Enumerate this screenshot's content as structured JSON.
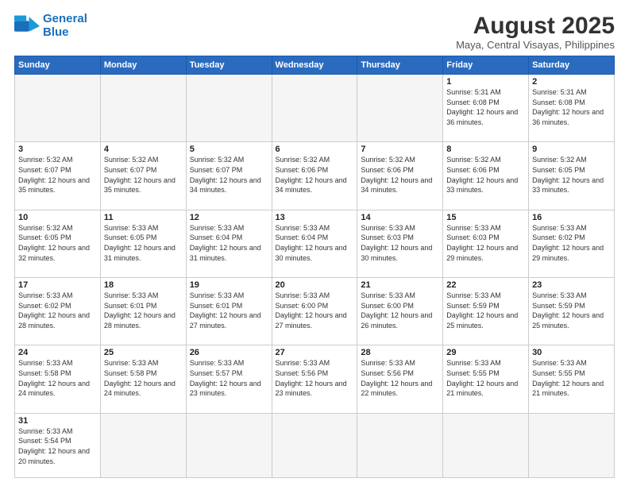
{
  "header": {
    "logo_general": "General",
    "logo_blue": "Blue",
    "month_title": "August 2025",
    "subtitle": "Maya, Central Visayas, Philippines"
  },
  "weekdays": [
    "Sunday",
    "Monday",
    "Tuesday",
    "Wednesday",
    "Thursday",
    "Friday",
    "Saturday"
  ],
  "weeks": [
    [
      {
        "day": "",
        "info": "",
        "empty": true
      },
      {
        "day": "",
        "info": "",
        "empty": true
      },
      {
        "day": "",
        "info": "",
        "empty": true
      },
      {
        "day": "",
        "info": "",
        "empty": true
      },
      {
        "day": "",
        "info": "",
        "empty": true
      },
      {
        "day": "1",
        "info": "Sunrise: 5:31 AM\nSunset: 6:08 PM\nDaylight: 12 hours\nand 36 minutes."
      },
      {
        "day": "2",
        "info": "Sunrise: 5:31 AM\nSunset: 6:08 PM\nDaylight: 12 hours\nand 36 minutes."
      }
    ],
    [
      {
        "day": "3",
        "info": "Sunrise: 5:32 AM\nSunset: 6:07 PM\nDaylight: 12 hours\nand 35 minutes."
      },
      {
        "day": "4",
        "info": "Sunrise: 5:32 AM\nSunset: 6:07 PM\nDaylight: 12 hours\nand 35 minutes."
      },
      {
        "day": "5",
        "info": "Sunrise: 5:32 AM\nSunset: 6:07 PM\nDaylight: 12 hours\nand 34 minutes."
      },
      {
        "day": "6",
        "info": "Sunrise: 5:32 AM\nSunset: 6:06 PM\nDaylight: 12 hours\nand 34 minutes."
      },
      {
        "day": "7",
        "info": "Sunrise: 5:32 AM\nSunset: 6:06 PM\nDaylight: 12 hours\nand 34 minutes."
      },
      {
        "day": "8",
        "info": "Sunrise: 5:32 AM\nSunset: 6:06 PM\nDaylight: 12 hours\nand 33 minutes."
      },
      {
        "day": "9",
        "info": "Sunrise: 5:32 AM\nSunset: 6:05 PM\nDaylight: 12 hours\nand 33 minutes."
      }
    ],
    [
      {
        "day": "10",
        "info": "Sunrise: 5:32 AM\nSunset: 6:05 PM\nDaylight: 12 hours\nand 32 minutes."
      },
      {
        "day": "11",
        "info": "Sunrise: 5:33 AM\nSunset: 6:05 PM\nDaylight: 12 hours\nand 31 minutes."
      },
      {
        "day": "12",
        "info": "Sunrise: 5:33 AM\nSunset: 6:04 PM\nDaylight: 12 hours\nand 31 minutes."
      },
      {
        "day": "13",
        "info": "Sunrise: 5:33 AM\nSunset: 6:04 PM\nDaylight: 12 hours\nand 30 minutes."
      },
      {
        "day": "14",
        "info": "Sunrise: 5:33 AM\nSunset: 6:03 PM\nDaylight: 12 hours\nand 30 minutes."
      },
      {
        "day": "15",
        "info": "Sunrise: 5:33 AM\nSunset: 6:03 PM\nDaylight: 12 hours\nand 29 minutes."
      },
      {
        "day": "16",
        "info": "Sunrise: 5:33 AM\nSunset: 6:02 PM\nDaylight: 12 hours\nand 29 minutes."
      }
    ],
    [
      {
        "day": "17",
        "info": "Sunrise: 5:33 AM\nSunset: 6:02 PM\nDaylight: 12 hours\nand 28 minutes."
      },
      {
        "day": "18",
        "info": "Sunrise: 5:33 AM\nSunset: 6:01 PM\nDaylight: 12 hours\nand 28 minutes."
      },
      {
        "day": "19",
        "info": "Sunrise: 5:33 AM\nSunset: 6:01 PM\nDaylight: 12 hours\nand 27 minutes."
      },
      {
        "day": "20",
        "info": "Sunrise: 5:33 AM\nSunset: 6:00 PM\nDaylight: 12 hours\nand 27 minutes."
      },
      {
        "day": "21",
        "info": "Sunrise: 5:33 AM\nSunset: 6:00 PM\nDaylight: 12 hours\nand 26 minutes."
      },
      {
        "day": "22",
        "info": "Sunrise: 5:33 AM\nSunset: 5:59 PM\nDaylight: 12 hours\nand 25 minutes."
      },
      {
        "day": "23",
        "info": "Sunrise: 5:33 AM\nSunset: 5:59 PM\nDaylight: 12 hours\nand 25 minutes."
      }
    ],
    [
      {
        "day": "24",
        "info": "Sunrise: 5:33 AM\nSunset: 5:58 PM\nDaylight: 12 hours\nand 24 minutes."
      },
      {
        "day": "25",
        "info": "Sunrise: 5:33 AM\nSunset: 5:58 PM\nDaylight: 12 hours\nand 24 minutes."
      },
      {
        "day": "26",
        "info": "Sunrise: 5:33 AM\nSunset: 5:57 PM\nDaylight: 12 hours\nand 23 minutes."
      },
      {
        "day": "27",
        "info": "Sunrise: 5:33 AM\nSunset: 5:56 PM\nDaylight: 12 hours\nand 23 minutes."
      },
      {
        "day": "28",
        "info": "Sunrise: 5:33 AM\nSunset: 5:56 PM\nDaylight: 12 hours\nand 22 minutes."
      },
      {
        "day": "29",
        "info": "Sunrise: 5:33 AM\nSunset: 5:55 PM\nDaylight: 12 hours\nand 21 minutes."
      },
      {
        "day": "30",
        "info": "Sunrise: 5:33 AM\nSunset: 5:55 PM\nDaylight: 12 hours\nand 21 minutes."
      }
    ],
    [
      {
        "day": "31",
        "info": "Sunrise: 5:33 AM\nSunset: 5:54 PM\nDaylight: 12 hours\nand 20 minutes.",
        "lastrow": true
      },
      {
        "day": "",
        "info": "",
        "empty": true,
        "lastrow": true
      },
      {
        "day": "",
        "info": "",
        "empty": true,
        "lastrow": true
      },
      {
        "day": "",
        "info": "",
        "empty": true,
        "lastrow": true
      },
      {
        "day": "",
        "info": "",
        "empty": true,
        "lastrow": true
      },
      {
        "day": "",
        "info": "",
        "empty": true,
        "lastrow": true
      },
      {
        "day": "",
        "info": "",
        "empty": true,
        "lastrow": true
      }
    ]
  ]
}
